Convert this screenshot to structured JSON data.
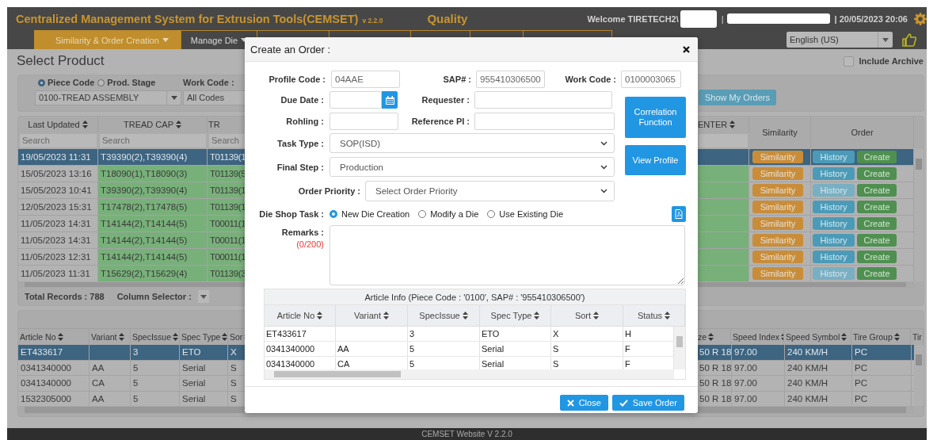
{
  "header": {
    "title": "Centralized Management System for Extrusion Tools(CEMSET)",
    "version": "v 2.2.0",
    "module": "Quality",
    "welcome": "Welcome TIRETECH2\\",
    "separator": "|",
    "datetime": "| 20/05/2023 20:06"
  },
  "nav": {
    "tabs": [
      {
        "label": "Similarity & Order Creation",
        "selected": true
      },
      {
        "label": "Manage Die",
        "selected": false
      }
    ],
    "language": "English (US)"
  },
  "page": {
    "title": "Select Product",
    "include_archive": {
      "label": "Include Archive",
      "checked": false
    }
  },
  "filters": {
    "modes": [
      {
        "label": "Piece Code",
        "selected": true
      },
      {
        "label": "Prod. Stage",
        "selected": false
      }
    ],
    "work_code_label": "Work Code :",
    "piece_code": "0100-TREAD ASSEMBLY",
    "work_code": "All Codes",
    "show_orders": "Show My Orders"
  },
  "products": {
    "columns": [
      "Last Updated",
      "TREAD CAP",
      "TR",
      "ENTER",
      "Similarity",
      "Order"
    ],
    "search_placeholders": [
      "Search",
      "Search",
      "Search"
    ],
    "rows": [
      {
        "last_updated": "19/05/2023 11:31",
        "tread_cap": "T39390(2),T39390(4)",
        "column_3": "T01139(1",
        "selected": true,
        "history_enabled": true,
        "similarity": "Similarity",
        "history": "History",
        "create": "Create"
      },
      {
        "last_updated": "15/05/2023 13:16",
        "tread_cap": "T18090(1),T18090(3)",
        "column_3": "T01139(5",
        "selected": false,
        "history_enabled": true,
        "similarity": "Similarity",
        "history": "History",
        "create": "Create"
      },
      {
        "last_updated": "15/05/2023 10:41",
        "tread_cap": "T39390(2),T39390(4)",
        "column_3": "T01139(1",
        "selected": false,
        "history_enabled": false,
        "similarity": "Similarity",
        "history": "History",
        "create": "Create"
      },
      {
        "last_updated": "12/05/2023 15:31",
        "tread_cap": "T17478(2),T17478(5)",
        "column_3": "T01139(1",
        "selected": false,
        "history_enabled": true,
        "similarity": "Similarity",
        "history": "History",
        "create": "Create"
      },
      {
        "last_updated": "11/05/2023 14:31",
        "tread_cap": "T14144(2),T14144(5)",
        "column_3": "T00011(1",
        "selected": false,
        "history_enabled": true,
        "similarity": "Similarity",
        "history": "History",
        "create": "Create"
      },
      {
        "last_updated": "11/05/2023 14:31",
        "tread_cap": "T14144(2),T14144(5)",
        "column_3": "T00011(1",
        "selected": false,
        "history_enabled": true,
        "similarity": "Similarity",
        "history": "History",
        "create": "Create"
      },
      {
        "last_updated": "11/05/2023 12:31",
        "tread_cap": "T14144(2),T14144(5)",
        "column_3": "T00011(1",
        "selected": false,
        "history_enabled": true,
        "similarity": "Similarity",
        "history": "History",
        "create": "Create"
      },
      {
        "last_updated": "11/05/2023 11:31",
        "tread_cap": "T15629(2),T15629(4)",
        "column_3": "T01139(3",
        "selected": false,
        "history_enabled": false,
        "similarity": "Similarity",
        "history": "History",
        "create": "Create"
      }
    ],
    "total_records": "Total Records : 788",
    "column_selector": "Column Selector :"
  },
  "articles": {
    "columns_left": [
      "Article No",
      "Variant",
      "SpecIssue",
      "Spec Type",
      "Sor"
    ],
    "columns_right": [
      "ze",
      "Speed Index",
      "Speed Symbol",
      "Tire Group",
      "Tir"
    ],
    "rows": [
      {
        "article_no": "ET433617",
        "spec_issue": "3",
        "spec_type": "ETO",
        "sort": "X",
        "size": "50 R 18",
        "speed_index": "97.00",
        "speed_symbol": "240 KM/H",
        "tire_group": "PC",
        "selected": true
      },
      {
        "article_no": "0341340000",
        "variant": "AA",
        "spec_issue": "5",
        "spec_type": "Serial",
        "sort": "S",
        "size": "50 R 18",
        "speed_index": "97.00",
        "speed_symbol": "240 KM/H",
        "tire_group": "PC",
        "selected": false
      },
      {
        "article_no": "0341340000",
        "variant": "CA",
        "spec_issue": "5",
        "spec_type": "Serial",
        "sort": "S",
        "size": "50 R 18",
        "speed_index": "97.00",
        "speed_symbol": "240 KM/H",
        "tire_group": "PC",
        "selected": false
      },
      {
        "article_no": "1532305000",
        "variant": "AA",
        "spec_issue": "5",
        "spec_type": "Serial",
        "sort": "S",
        "size": "50 R 18",
        "speed_index": "97.00",
        "speed_symbol": "240 KM/H",
        "tire_group": "PC",
        "selected": false
      }
    ]
  },
  "modal": {
    "title": "Create an Order :",
    "profile_code": {
      "label": "Profile Code :",
      "value": "04AAE"
    },
    "sap": {
      "label": "SAP# :",
      "value": "955410306500"
    },
    "work_code": {
      "label": "Work Code :",
      "value": "0100003065"
    },
    "due_date": {
      "label": "Due Date :"
    },
    "requester": {
      "label": "Requester :"
    },
    "rohling": {
      "label": "Rohling :"
    },
    "reference_pi": {
      "label": "Reference PI :"
    },
    "task_type": {
      "label": "Task Type :",
      "value": "SOP(ISD)"
    },
    "final_step": {
      "label": "Final Step :",
      "value": "Production"
    },
    "order_priority": {
      "label": "Order Priority :",
      "placeholder": "Select Order Priority"
    },
    "correlation_button": "Correlation Function",
    "view_profile_button": "View Profile",
    "die_shop_task": {
      "label": "Die Shop Task :",
      "options": [
        {
          "label": "New Die Creation",
          "selected": true
        },
        {
          "label": "Modify a Die",
          "selected": false
        },
        {
          "label": "Use Existing Die",
          "selected": false
        }
      ]
    },
    "remarks": {
      "label": "Remarks :",
      "counter": "(0/200)"
    },
    "article_info": {
      "title": "Article Info (Piece Code : '0100', SAP# : '955410306500')",
      "columns": [
        "Article No",
        "Variant",
        "SpecIssue",
        "Spec Type",
        "Sort",
        "Status"
      ],
      "rows": [
        {
          "article_no": "ET433617",
          "spec_issue": "3",
          "spec_type": "ETO",
          "sort": "X",
          "status": "H"
        },
        {
          "article_no": "0341340000",
          "variant": "AA",
          "spec_issue": "5",
          "spec_type": "Serial",
          "sort": "S",
          "status": "F"
        },
        {
          "article_no": "0341340000",
          "variant": "CA",
          "spec_issue": "5",
          "spec_type": "Serial",
          "sort": "S",
          "status": "F"
        }
      ]
    },
    "close_button": "Close",
    "save_button": "Save Order"
  },
  "footer": "CEMSET Website V 2.2.0"
}
